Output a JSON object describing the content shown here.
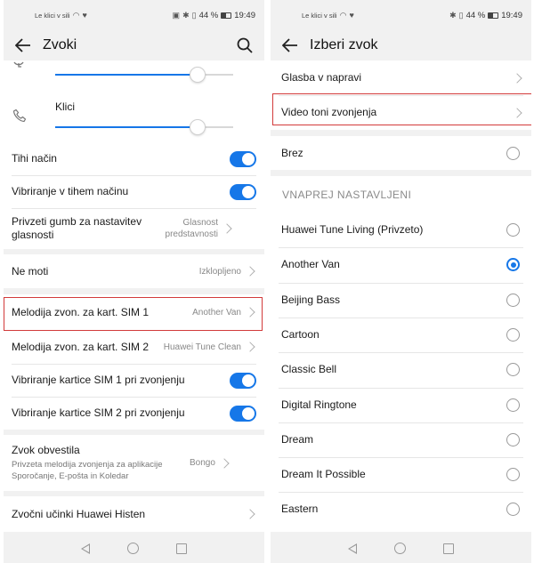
{
  "left": {
    "status": {
      "carrier": "Le klici v sili",
      "battery": "44 %",
      "time": "19:49"
    },
    "title": "Zvoki",
    "ringtone_label": "Klici",
    "rows": {
      "silent": "Tihi način",
      "vibrate_silent": "Vibriranje v tihem načinu",
      "volume_button_label": "Privzeti gumb za nastavitev glasnosti",
      "volume_button_value": "Glasnost predstavnosti",
      "dnd_label": "Ne moti",
      "dnd_value": "Izklopljeno",
      "sim1_label": "Melodija zvon. za kart. SIM 1",
      "sim1_value": "Another Van",
      "sim2_label": "Melodija zvon. za kart. SIM 2",
      "sim2_value": "Huawei Tune Clean",
      "vib_sim1": "Vibriranje kartice SIM 1 pri zvonjenju",
      "vib_sim2": "Vibriranje kartice SIM 2 pri zvonjenju",
      "notif_label": "Zvok obvestila",
      "notif_sub": "Privzeta melodija zvonjenja za aplikacije Sporočanje, E-pošta in Koledar",
      "notif_value": "Bongo",
      "histen_label": "Zvočni učinki Huawei Histen"
    },
    "toggles": {
      "silent": true,
      "vibrate_silent": true,
      "vib_sim1": true,
      "vib_sim2": true
    },
    "sliders": {
      "alarm_level": 0.8,
      "calls_level": 0.8
    }
  },
  "right": {
    "status": {
      "carrier": "Le klici v sili",
      "battery": "44 %",
      "time": "19:49"
    },
    "title": "Izberi zvok",
    "device_music": "Glasba v napravi",
    "video_ringtones": "Video toni zvonjenja",
    "none": "Brez",
    "preset_header": "VNAPREJ NASTAVLJENI",
    "ringtones": [
      {
        "name": "Huawei Tune Living (Privzeto)",
        "selected": false
      },
      {
        "name": "Another Van",
        "selected": true
      },
      {
        "name": "Beijing Bass",
        "selected": false
      },
      {
        "name": "Cartoon",
        "selected": false
      },
      {
        "name": "Classic Bell",
        "selected": false
      },
      {
        "name": "Digital Ringtone",
        "selected": false
      },
      {
        "name": "Dream",
        "selected": false
      },
      {
        "name": "Dream It Possible",
        "selected": false
      },
      {
        "name": "Eastern",
        "selected": false
      }
    ]
  },
  "colors": {
    "accent": "#1677e8",
    "highlight": "#d23a3a"
  }
}
